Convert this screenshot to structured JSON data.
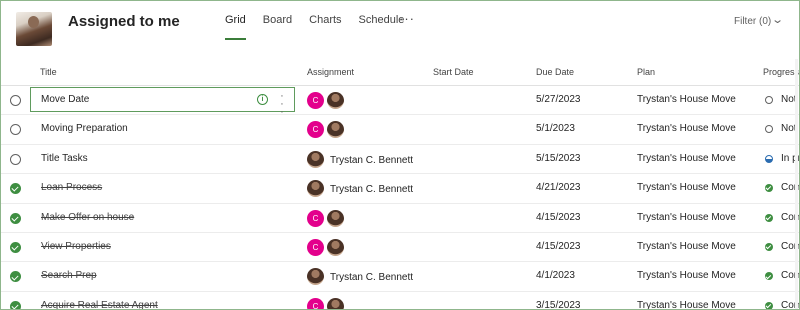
{
  "header": {
    "title": "Assigned to me",
    "tabs": [
      {
        "label": "Grid",
        "active": true
      },
      {
        "label": "Board"
      },
      {
        "label": "Charts"
      },
      {
        "label": "Schedule"
      }
    ],
    "more_label": "···",
    "filter_label": "Filter (0)"
  },
  "columns": {
    "title": "Title",
    "assignment": "Assignment",
    "start_date": "Start Date",
    "due_date": "Due Date",
    "plan": "Plan",
    "progress": "Progress"
  },
  "rows": [
    {
      "title": "Move Date",
      "completed": false,
      "assignee": "",
      "avatar_initial": "C",
      "due": "5/27/2023",
      "plan": "Trystan's House Move",
      "progress": "Not",
      "progress_state": "not-started",
      "selected": true
    },
    {
      "title": "Moving Preparation",
      "completed": false,
      "assignee": "",
      "avatar_initial": "C",
      "due": "5/1/2023",
      "plan": "Trystan's House Move",
      "progress": "Not",
      "progress_state": "not-started"
    },
    {
      "title": "Title Tasks",
      "completed": false,
      "assignee": "Trystan C. Bennett",
      "avatar_initial": "",
      "due": "5/15/2023",
      "plan": "Trystan's House Move",
      "progress": "In pr",
      "progress_state": "in-progress"
    },
    {
      "title": "Loan Process",
      "completed": true,
      "assignee": "Trystan C. Bennett",
      "avatar_initial": "",
      "due": "4/21/2023",
      "plan": "Trystan's House Move",
      "progress": "Com",
      "progress_state": "completed"
    },
    {
      "title": "Make Offer on house",
      "completed": true,
      "assignee": "",
      "avatar_initial": "C",
      "due": "4/15/2023",
      "plan": "Trystan's House Move",
      "progress": "Com",
      "progress_state": "completed"
    },
    {
      "title": "View Properties",
      "completed": true,
      "assignee": "",
      "avatar_initial": "C",
      "due": "4/15/2023",
      "plan": "Trystan's House Move",
      "progress": "Com",
      "progress_state": "completed"
    },
    {
      "title": "Search Prep",
      "completed": true,
      "assignee": "Trystan C. Bennett",
      "avatar_initial": "",
      "due": "4/1/2023",
      "plan": "Trystan's House Move",
      "progress": "Com",
      "progress_state": "completed"
    },
    {
      "title": "Acquire Real Estate Agent",
      "completed": true,
      "assignee": "",
      "avatar_initial": "C",
      "due": "3/15/2023",
      "plan": "Trystan's House Move",
      "progress": "Com",
      "progress_state": "completed"
    }
  ],
  "colors": {
    "accent": "#3b7d3a",
    "completed": "#3e8e41",
    "avatar_c": "#e3008c",
    "in_progress": "#2b6cb0"
  },
  "icons": {
    "row_info": "info-icon",
    "row_more": "more-vertical-icon",
    "filter_chevron": "chevron-down-icon"
  }
}
